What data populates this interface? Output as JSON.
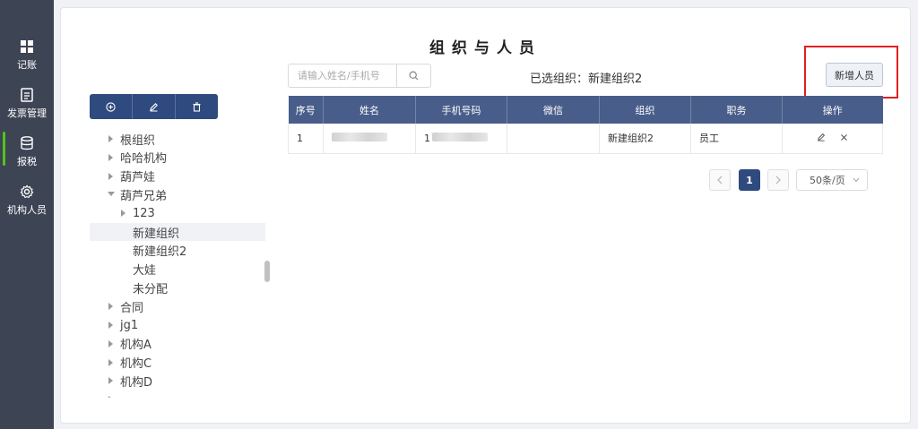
{
  "sidebar": {
    "items": [
      {
        "label": "记账",
        "icon": "grid-icon"
      },
      {
        "label": "发票管理",
        "icon": "document-icon"
      },
      {
        "label": "报税",
        "icon": "database-icon"
      },
      {
        "label": "机构人员",
        "icon": "gear-icon"
      }
    ]
  },
  "page": {
    "title": "组织与人员"
  },
  "search": {
    "placeholder": "请输入姓名/手机号",
    "value": ""
  },
  "selected_org": "已选组织：新建组织2",
  "add_button": "新增人员",
  "tree": [
    {
      "label": "根组织",
      "level": 0,
      "expanded": false
    },
    {
      "label": "哈哈机构",
      "level": 0,
      "expanded": false
    },
    {
      "label": "葫芦娃",
      "level": 0,
      "expanded": false
    },
    {
      "label": "葫芦兄弟",
      "level": 0,
      "expanded": true
    },
    {
      "label": "123",
      "level": 1,
      "expanded": false
    },
    {
      "label": "新建组织",
      "level": 1,
      "leaf": true,
      "selected": true
    },
    {
      "label": "新建组织2",
      "level": 1,
      "leaf": true
    },
    {
      "label": "大娃",
      "level": 1,
      "leaf": true
    },
    {
      "label": "未分配",
      "level": 1,
      "leaf": true
    },
    {
      "label": "合同",
      "level": 0,
      "expanded": false
    },
    {
      "label": "jg1",
      "level": 0,
      "expanded": false
    },
    {
      "label": "机构A",
      "level": 0,
      "expanded": false
    },
    {
      "label": "机构C",
      "level": 0,
      "expanded": false
    },
    {
      "label": "机构D",
      "level": 0,
      "expanded": false
    },
    {
      "label": "",
      "level": 0,
      "expanded": false
    }
  ],
  "table": {
    "columns": [
      "序号",
      "姓名",
      "手机号码",
      "微信",
      "组织",
      "职务",
      "操作"
    ],
    "rows": [
      {
        "index": "1",
        "name": "",
        "phone": "1",
        "wechat": "",
        "org": "新建组织2",
        "role": "员工"
      }
    ]
  },
  "pagination": {
    "current": "1",
    "page_size": "50条/页"
  },
  "colors": {
    "primary": "#2e4a7e",
    "table_header": "#495d8a",
    "highlight": "#e02020",
    "sidebar": "#3d4454"
  }
}
